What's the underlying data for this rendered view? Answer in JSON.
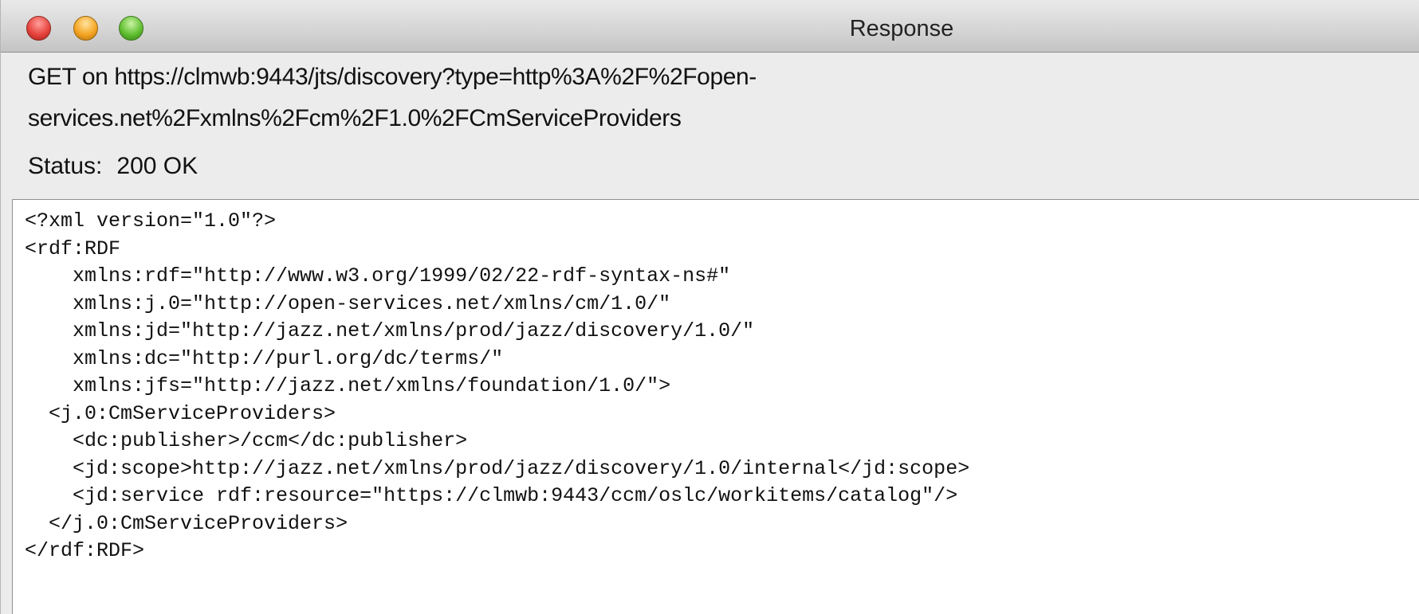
{
  "window": {
    "title": "Response"
  },
  "request": {
    "line1": "GET on https://clmwb:9443/jts/discovery?type=http%3A%2F%2Fopen-",
    "line2": "services.net%2Fxmlns%2Fcm%2F1.0%2FCmServiceProviders"
  },
  "status": {
    "label": "Status:",
    "value": "200 OK"
  },
  "response_body": {
    "lines": [
      "<?xml version=\"1.0\"?>",
      "<rdf:RDF",
      "    xmlns:rdf=\"http://www.w3.org/1999/02/22-rdf-syntax-ns#\"",
      "    xmlns:j.0=\"http://open-services.net/xmlns/cm/1.0/\"",
      "    xmlns:jd=\"http://jazz.net/xmlns/prod/jazz/discovery/1.0/\"",
      "    xmlns:dc=\"http://purl.org/dc/terms/\"",
      "    xmlns:jfs=\"http://jazz.net/xmlns/foundation/1.0/\">",
      "  <j.0:CmServiceProviders>",
      "    <dc:publisher>/ccm</dc:publisher>",
      "    <jd:scope>http://jazz.net/xmlns/prod/jazz/discovery/1.0/internal</jd:scope>",
      "    <jd:service rdf:resource=\"https://clmwb:9443/ccm/oslc/workitems/catalog\"/>",
      "  </j.0:CmServiceProviders>",
      "</rdf:RDF>"
    ]
  }
}
